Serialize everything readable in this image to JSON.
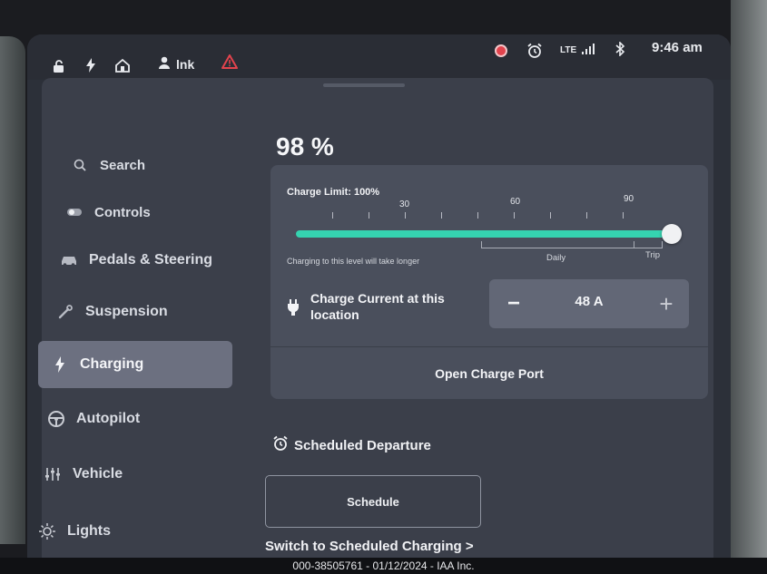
{
  "status_bar": {
    "user_name": "lnk",
    "network": "LTE",
    "clock": "9:46 am"
  },
  "sidebar": {
    "items": [
      {
        "label": "Search",
        "icon": "search-icon"
      },
      {
        "label": "Controls",
        "icon": "toggle-icon"
      },
      {
        "label": "Pedals & Steering",
        "icon": "car-icon"
      },
      {
        "label": "Suspension",
        "icon": "wrench-icon"
      },
      {
        "label": "Charging",
        "icon": "bolt-icon",
        "active": true
      },
      {
        "label": "Autopilot",
        "icon": "steering-wheel-icon"
      },
      {
        "label": "Vehicle",
        "icon": "sliders-icon"
      },
      {
        "label": "Lights",
        "icon": "sun-icon"
      }
    ]
  },
  "charging": {
    "battery_percent": "98 %",
    "charge_limit_label": "Charge Limit: 100%",
    "charge_limit_value": 1.0,
    "scale_labels": [
      "30",
      "60",
      "90"
    ],
    "hint": "Charging to this level will take longer",
    "daily_label": "Daily",
    "trip_label": "Trip",
    "charge_current_label": "Charge Current at this location",
    "charge_current_value": "48 A",
    "minus_label": "−",
    "plus_label": "+",
    "open_port_label": "Open Charge Port",
    "fill_color": "#35d3b0"
  },
  "scheduled": {
    "title": "Scheduled Departure",
    "schedule_button": "Schedule",
    "switch_link": "Switch to Scheduled Charging >"
  },
  "watermark": "000-38505761 - 01/12/2024 - IAA Inc."
}
